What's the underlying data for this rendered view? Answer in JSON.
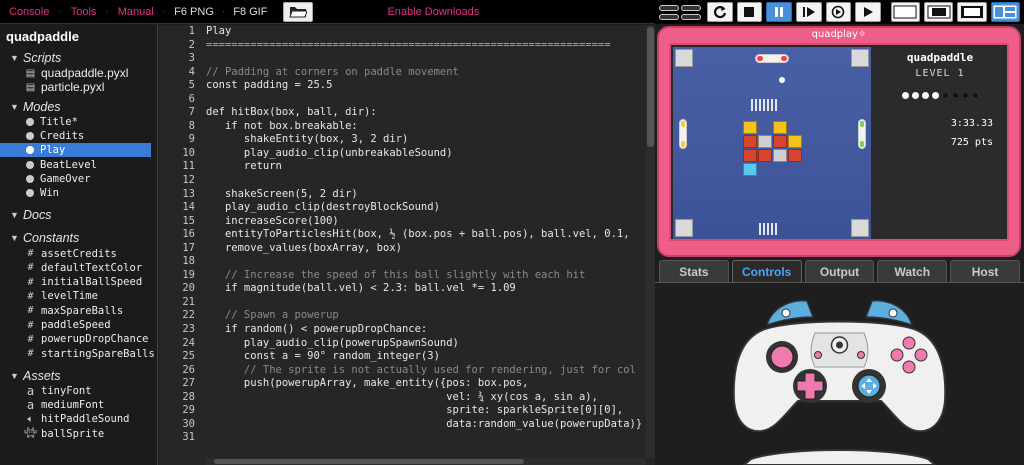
{
  "menu": {
    "console": "Console",
    "tools": "Tools",
    "manual": "Manual",
    "sep": "·",
    "f6png": "F6 PNG",
    "f8gif": "F8 GIF",
    "enable_downloads": "Enable Downloads"
  },
  "toolbar": {
    "buttons": [
      "restart-icon",
      "stop-icon",
      "pause-icon",
      "step-icon",
      "debug-icon",
      "play-icon"
    ],
    "active": "pause-icon",
    "layouts": [
      "layout-small-icon",
      "layout-medium-icon",
      "layout-large-icon",
      "layout-ide-icon"
    ]
  },
  "sidebar": {
    "project": "quadpaddle",
    "scripts_title": "Scripts",
    "scripts": [
      "quadpaddle.pyxl",
      "particle.pyxl"
    ],
    "modes_title": "Modes",
    "modes": [
      "Title*",
      "Credits",
      "Play",
      "BeatLevel",
      "GameOver",
      "Win"
    ],
    "selected_mode": "Play",
    "docs_title": "Docs",
    "constants_title": "Constants",
    "constants": [
      "assetCredits",
      "defaultTextColor",
      "initialBallSpeed",
      "levelTime",
      "maxSpareBalls",
      "paddleSpeed",
      "powerupDropChance",
      "startingSpareBalls"
    ],
    "assets_title": "Assets",
    "assets": [
      {
        "icon": "a",
        "name": "tinyFont"
      },
      {
        "icon": "a",
        "name": "mediumFont"
      },
      {
        "icon": "speaker",
        "name": "hitPaddleSound"
      },
      {
        "icon": "sprite",
        "name": "ballSprite"
      }
    ]
  },
  "editor": {
    "lines": [
      "Play",
      "================================================================",
      "",
      "// Padding at corners on paddle movement",
      "const padding = 25.5",
      "",
      "def hitBox(box, ball, dir):",
      "   if not box.breakable:",
      "      shakeEntity(box, 3, 2 dir)",
      "      play_audio_clip(unbreakableSound)",
      "      return",
      "",
      "   shakeScreen(5, 2 dir)",
      "   play_audio_clip(destroyBlockSound)",
      "   increaseScore(100)",
      "   entityToParticlesHit(box, ½ (box.pos + ball.pos), ball.vel, 0.1, ",
      "   remove_values(boxArray, box)",
      "",
      "   // Increase the speed of this ball slightly with each hit",
      "   if magnitude(ball.vel) < 2.3: ball.vel *= 1.09",
      "",
      "   // Spawn a powerup",
      "   if random() < powerupDropChance:",
      "      play_audio_clip(powerupSpawnSound)",
      "      const a = 90° random_integer(3)",
      "      // The sprite is not actually used for rendering, just for col",
      "      push(powerupArray, make_entity({pos: box.pos,",
      "                                      vel: ¾ xy(cos a, sin a),",
      "                                      sprite: sparkleSprite[0][0],",
      "                                      data:random_value(powerupData)}",
      ""
    ]
  },
  "console": {
    "brand": "quadplay✧",
    "game_title": "quadpaddle",
    "level": "LEVEL 1",
    "balls_on": 4,
    "balls_total": 8,
    "time": "3:33.33",
    "score": "725 pts"
  },
  "tabs": [
    "Stats",
    "Controls",
    "Output",
    "Watch",
    "Host"
  ],
  "active_tab": "Controls",
  "colors": {
    "accent": "#e0328a",
    "selected": "#3a7bd5",
    "console_pink": "#ef5e86",
    "field_blue": "#4a60a6",
    "tab_active": "#4aa3ff"
  }
}
